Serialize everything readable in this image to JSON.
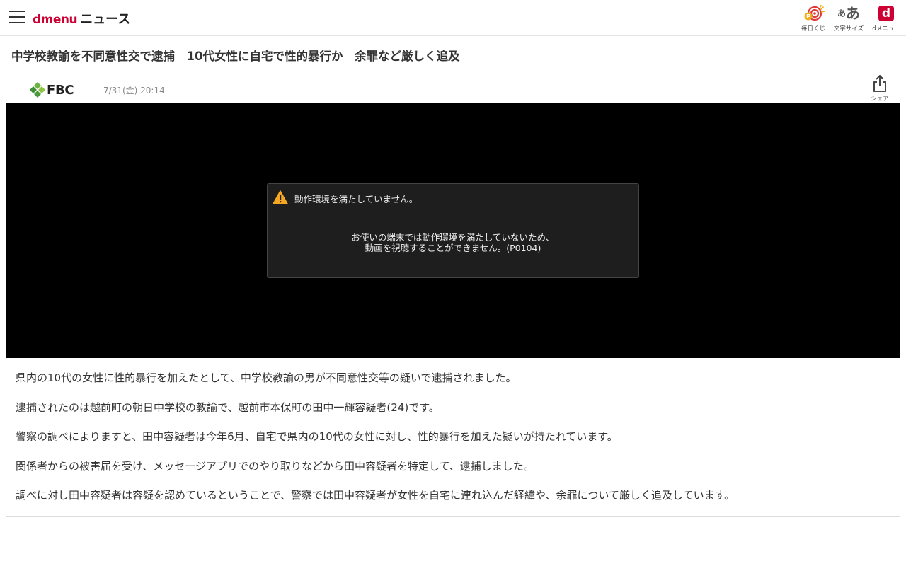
{
  "header": {
    "logo_brand": "dmenu",
    "logo_section": "ニュース",
    "buttons": [
      {
        "label": "毎日くじ",
        "icon": "lottery-target-icon"
      },
      {
        "label": "文字サイズ",
        "icon_small": "あ",
        "icon_big": "あ"
      },
      {
        "label": "dメニュー",
        "icon_text": "d"
      }
    ]
  },
  "article": {
    "title": "中学校教諭を不同意性交で逮捕　10代女性に自宅で性的暴行か　余罪など厳しく追及",
    "source": "FBC",
    "date": "7/31(金) 20:14",
    "share_label": "シェア",
    "paragraphs": [
      "県内の10代の女性に性的暴行を加えたとして、中学校教諭の男が不同意性交等の疑いで逮捕されました。",
      "逮捕されたのは越前町の朝日中学校の教諭で、越前市本保町の田中一輝容疑者(24)です。",
      "警察の調べによりますと、田中容疑者は今年6月、自宅で県内の10代の女性に対し、性的暴行を加えた疑いが持たれています。",
      "関係者からの被害届を受け、メッセージアプリでのやり取りなどから田中容疑者を特定して、逮捕しました。",
      "調べに対し田中容疑者は容疑を認めているということで、警察では田中容疑者が女性を自宅に連れ込んだ経緯や、余罪について厳しく追及しています。"
    ]
  },
  "video": {
    "error_title": "動作環境を満たしていません。",
    "error_line1": "お使いの端末では動作環境を満たしていないため、",
    "error_line2": "動画を視聴することができません。(P0104)"
  },
  "colors": {
    "brand_red": "#cc0033",
    "warning_orange": "#f5a623",
    "fbc_green": "#4a9a3c"
  }
}
